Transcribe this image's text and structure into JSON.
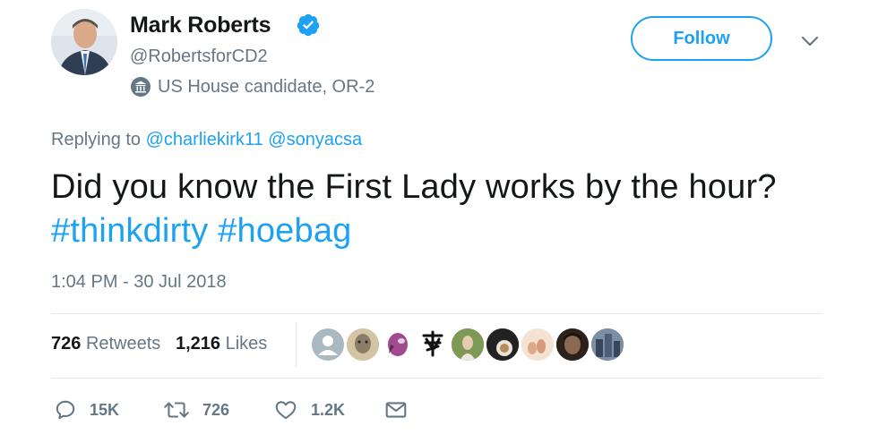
{
  "author": {
    "name": "Mark Roberts",
    "handle": "@RobertsforCD2",
    "label": "US House candidate, OR-2"
  },
  "actions_top": {
    "follow": "Follow"
  },
  "reply": {
    "prefix": "Replying to",
    "mentions": [
      "@charliekirk11",
      "@sonyacsa"
    ]
  },
  "tweet": {
    "text": "Did you know the First Lady works by the hour?",
    "hashtags": [
      "#thinkdirty",
      "#hoebag"
    ],
    "timestamp": "1:04 PM - 30 Jul 2018"
  },
  "stats": {
    "retweets_count": "726",
    "retweets_label": "Retweets",
    "likes_count": "1,216",
    "likes_label": "Likes"
  },
  "actions": {
    "reply_count": "15K",
    "retweet_count": "726",
    "like_count": "1.2K"
  },
  "colors": {
    "accent": "#1da1f2",
    "muted": "#657786",
    "text": "#14171a",
    "divider": "#e1e8ed"
  },
  "icons": [
    "verified-badge-icon",
    "government-label-icon",
    "chevron-down-icon",
    "reply-icon",
    "retweet-icon",
    "like-icon",
    "message-icon"
  ]
}
